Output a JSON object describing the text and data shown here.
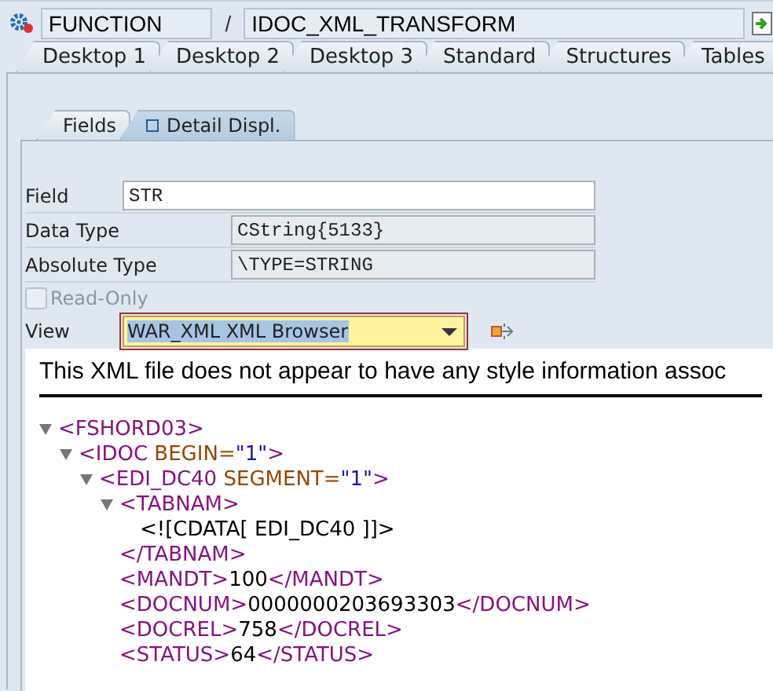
{
  "header": {
    "object_type": "FUNCTION",
    "separator": "/",
    "object_name": "IDOC_XML_TRANSFORM"
  },
  "desktop_tabs": [
    {
      "label": "Desktop 1",
      "selected": false
    },
    {
      "label": "Desktop 2",
      "selected": false
    },
    {
      "label": "Desktop 3",
      "selected": false
    },
    {
      "label": "Standard",
      "selected": false
    },
    {
      "label": "Structures",
      "selected": false
    },
    {
      "label": "Tables",
      "selected": false
    }
  ],
  "detail_tabs": [
    {
      "label": "Fields",
      "selected": false,
      "icon": false
    },
    {
      "label": "Detail Displ.",
      "selected": true,
      "icon": true
    }
  ],
  "form": {
    "rows": [
      {
        "label": "Field",
        "value": "STR",
        "editable": true
      },
      {
        "label": "Data Type",
        "value": "CString{5133}",
        "editable": false
      },
      {
        "label": "Absolute Type",
        "value": "\\TYPE=STRING",
        "editable": false
      }
    ],
    "read_only": {
      "label": "Read-Only",
      "checked": false,
      "disabled": true
    },
    "view": {
      "label": "View",
      "value": "WAR_XML XML Browser"
    }
  },
  "xml_browser": {
    "notice": "This XML file does not appear to have any style information assoc",
    "tree": [
      {
        "kind": "element",
        "expanded": true,
        "parts": [
          {
            "tag": "<FSHORD03>"
          }
        ],
        "children": [
          {
            "kind": "element",
            "expanded": true,
            "parts": [
              {
                "tag": "<IDOC"
              },
              {
                "attr": " BEGIN="
              },
              {
                "value": "\"1\""
              },
              {
                "tag": ">"
              }
            ],
            "children": [
              {
                "kind": "element",
                "expanded": true,
                "parts": [
                  {
                    "tag": "<EDI_DC40"
                  },
                  {
                    "attr": " SEGMENT="
                  },
                  {
                    "value": "\"1\""
                  },
                  {
                    "tag": ">"
                  }
                ],
                "children": [
                  {
                    "kind": "element",
                    "expanded": true,
                    "parts": [
                      {
                        "tag": "<TABNAM>"
                      }
                    ],
                    "children": [
                      {
                        "kind": "leaf",
                        "parts": [
                          {
                            "text": "<![CDATA[ EDI_DC40 ]]>"
                          }
                        ]
                      }
                    ],
                    "close": [
                      {
                        "tag": "</TABNAM>"
                      }
                    ]
                  },
                  {
                    "kind": "leaf",
                    "parts": [
                      {
                        "tag": "<MANDT>"
                      },
                      {
                        "text": "100"
                      },
                      {
                        "tag": "</MANDT>"
                      }
                    ]
                  },
                  {
                    "kind": "leaf",
                    "parts": [
                      {
                        "tag": "<DOCNUM>"
                      },
                      {
                        "text": "0000000203693303"
                      },
                      {
                        "tag": "</DOCNUM>"
                      }
                    ]
                  },
                  {
                    "kind": "leaf",
                    "parts": [
                      {
                        "tag": "<DOCREL>"
                      },
                      {
                        "text": "758"
                      },
                      {
                        "tag": "</DOCREL>"
                      }
                    ]
                  },
                  {
                    "kind": "leaf",
                    "parts": [
                      {
                        "tag": "<STATUS>"
                      },
                      {
                        "text": "64"
                      },
                      {
                        "tag": "</STATUS>"
                      }
                    ]
                  }
                ]
              }
            ]
          }
        ]
      }
    ]
  }
}
